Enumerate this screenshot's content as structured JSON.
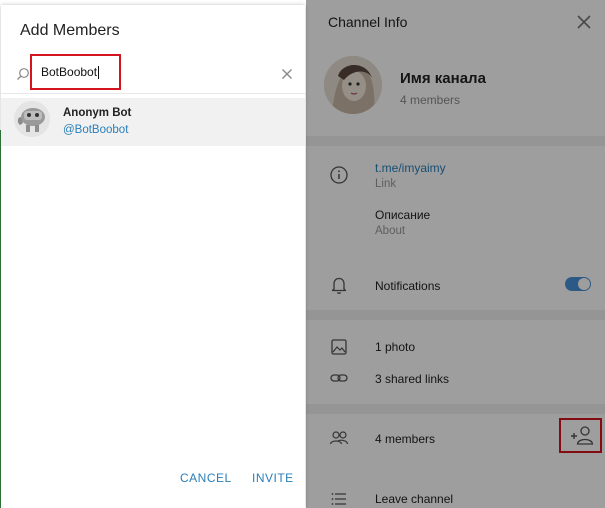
{
  "add_members_dialog": {
    "title": "Add Members",
    "search": {
      "value": "BotBoobot",
      "placeholder": ""
    },
    "results": [
      {
        "name": "Anonym Bot",
        "username": "@BotBoobot"
      }
    ],
    "cancel_label": "CANCEL",
    "invite_label": "INVITE"
  },
  "channel_info": {
    "title": "Channel Info",
    "channel_name": "Имя канала",
    "members_subtitle": "4 members",
    "link": {
      "value": "t.me/imyaimy",
      "label": "Link"
    },
    "about": {
      "value": "Описание",
      "label": "About"
    },
    "notifications_label": "Notifications",
    "notifications_on": true,
    "photos_label": "1 photo",
    "shared_links_label": "3 shared links",
    "members_label": "4 members",
    "leave_label": "Leave channel"
  },
  "colors": {
    "accent": "#2a7fb8",
    "toggle": "#4a90d9",
    "highlight_box": "#d4141e"
  },
  "icons": {
    "search": "search-icon",
    "clear": "close-icon",
    "close": "close-icon",
    "info": "info-icon",
    "bell": "bell-icon",
    "photo": "photo-icon",
    "link": "link-icon",
    "members": "members-icon",
    "add_member": "add-member-icon",
    "leave": "list-icon"
  }
}
